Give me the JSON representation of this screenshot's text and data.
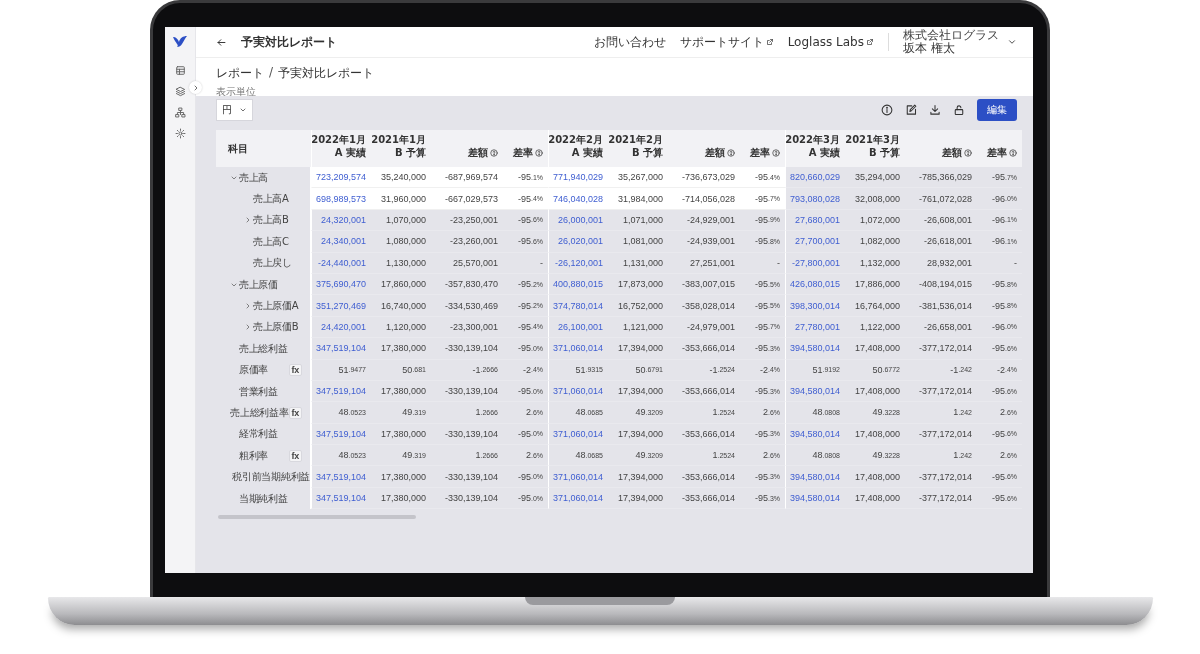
{
  "app": {
    "title": "予実対比レポート"
  },
  "header_links": [
    {
      "label": "お問い合わせ",
      "external": false
    },
    {
      "label": "サポートサイト",
      "external": true
    },
    {
      "label": "Loglass Labs",
      "external": true
    }
  ],
  "user": {
    "company": "株式会社ログラス",
    "name": "坂本 権太"
  },
  "breadcrumb": [
    "レポート",
    "予実対比レポート"
  ],
  "breadcrumb_separator": "/",
  "unit": {
    "label": "表示単位",
    "value": "円"
  },
  "edit_button": "編集",
  "table": {
    "label_header": "科目",
    "months": [
      {
        "current": "2022年1月",
        "actual": "A 実績",
        "prior": "2021年1月",
        "budget": "B 予算",
        "diff": "差額",
        "rate": "差率"
      },
      {
        "current": "2022年2月",
        "actual": "A 実績",
        "prior": "2021年2月",
        "budget": "B 予算",
        "diff": "差額",
        "rate": "差率"
      },
      {
        "current": "2022年3月",
        "actual": "A 実績",
        "prior": "2021年3月",
        "budget": "B 予算",
        "diff": "差額",
        "rate": "差率"
      }
    ],
    "rows": [
      {
        "label": "売上高",
        "kind": "amount",
        "expanded": true,
        "months": [
          {
            "values": [
              "723,209,574",
              "35,240,000",
              "-687,969,574",
              "-95.1%"
            ],
            "highlighted": true
          },
          {
            "values": [
              "771,940,029",
              "35,267,000",
              "-736,673,029",
              "-95.4%"
            ],
            "highlighted": true
          },
          {
            "values": [
              "820,660,029",
              "35,294,000",
              "-785,366,029",
              "-95.7%"
            ],
            "highlighted": false
          }
        ],
        "children": [
          {
            "label": "売上高A",
            "kind": "amount",
            "months": [
              {
                "values": [
                  "698,989,573",
                  "31,960,000",
                  "-667,029,573",
                  "-95.4%"
                ],
                "highlighted": true
              },
              {
                "values": [
                  "746,040,028",
                  "31,984,000",
                  "-714,056,028",
                  "-95.7%"
                ],
                "highlighted": true
              },
              {
                "values": [
                  "793,080,028",
                  "32,008,000",
                  "-761,072,028",
                  "-96.0%"
                ],
                "highlighted": false
              }
            ]
          },
          {
            "label": "売上高B",
            "kind": "amount",
            "expanded": false,
            "months": [
              {
                "values": [
                  "24,320,001",
                  "1,070,000",
                  "-23,250,001",
                  "-95.6%"
                ],
                "highlighted": false
              },
              {
                "values": [
                  "26,000,001",
                  "1,071,000",
                  "-24,929,001",
                  "-95.9%"
                ],
                "highlighted": false
              },
              {
                "values": [
                  "27,680,001",
                  "1,072,000",
                  "-26,608,001",
                  "-96.1%"
                ],
                "highlighted": false
              }
            ]
          },
          {
            "label": "売上高C",
            "kind": "amount",
            "months": [
              {
                "values": [
                  "24,340,001",
                  "1,080,000",
                  "-23,260,001",
                  "-95.6%"
                ],
                "highlighted": false
              },
              {
                "values": [
                  "26,020,001",
                  "1,081,000",
                  "-24,939,001",
                  "-95.8%"
                ],
                "highlighted": false
              },
              {
                "values": [
                  "27,700,001",
                  "1,082,000",
                  "-26,618,001",
                  "-96.1%"
                ],
                "highlighted": false
              }
            ]
          },
          {
            "label": "売上戻し",
            "kind": "amount",
            "months": [
              {
                "values": [
                  "-24,440,001",
                  "1,130,000",
                  "25,570,001",
                  "-"
                ],
                "highlighted": false
              },
              {
                "values": [
                  "-26,120,001",
                  "1,131,000",
                  "27,251,001",
                  "-"
                ],
                "highlighted": false
              },
              {
                "values": [
                  "-27,800,001",
                  "1,132,000",
                  "28,932,001",
                  "-"
                ],
                "highlighted": false
              }
            ]
          }
        ]
      },
      {
        "label": "売上原価",
        "kind": "amount",
        "expanded": true,
        "months": [
          {
            "values": [
              "375,690,470",
              "17,860,000",
              "-357,830,470",
              "-95.2%"
            ],
            "highlighted": false
          },
          {
            "values": [
              "400,880,015",
              "17,873,000",
              "-383,007,015",
              "-95.5%"
            ],
            "highlighted": false
          },
          {
            "values": [
              "426,080,015",
              "17,886,000",
              "-408,194,015",
              "-95.8%"
            ],
            "highlighted": false
          }
        ],
        "children": [
          {
            "label": "売上原価A",
            "kind": "amount",
            "expanded": false,
            "months": [
              {
                "values": [
                  "351,270,469",
                  "16,740,000",
                  "-334,530,469",
                  "-95.2%"
                ],
                "highlighted": false
              },
              {
                "values": [
                  "374,780,014",
                  "16,752,000",
                  "-358,028,014",
                  "-95.5%"
                ],
                "highlighted": false
              },
              {
                "values": [
                  "398,300,014",
                  "16,764,000",
                  "-381,536,014",
                  "-95.8%"
                ],
                "highlighted": false
              }
            ]
          },
          {
            "label": "売上原価B",
            "kind": "amount",
            "expanded": false,
            "months": [
              {
                "values": [
                  "24,420,001",
                  "1,120,000",
                  "-23,300,001",
                  "-95.4%"
                ],
                "highlighted": false
              },
              {
                "values": [
                  "26,100,001",
                  "1,121,000",
                  "-24,979,001",
                  "-95.7%"
                ],
                "highlighted": false
              },
              {
                "values": [
                  "27,780,001",
                  "1,122,000",
                  "-26,658,001",
                  "-96.0%"
                ],
                "highlighted": false
              }
            ]
          }
        ]
      },
      {
        "label": "売上総利益",
        "kind": "amount",
        "months": [
          {
            "values": [
              "347,519,104",
              "17,380,000",
              "-330,139,104",
              "-95.0%"
            ],
            "highlighted": false
          },
          {
            "values": [
              "371,060,014",
              "17,394,000",
              "-353,666,014",
              "-95.3%"
            ],
            "highlighted": false
          },
          {
            "values": [
              "394,580,014",
              "17,408,000",
              "-377,172,014",
              "-95.6%"
            ],
            "highlighted": false
          }
        ]
      },
      {
        "label": "原価率",
        "kind": "ratio",
        "badge": "fx",
        "months": [
          {
            "values": [
              "51.9477",
              "50.681",
              "-1.2666",
              "-2.4%"
            ],
            "highlighted": false
          },
          {
            "values": [
              "51.9315",
              "50.6791",
              "-1.2524",
              "-2.4%"
            ],
            "highlighted": false
          },
          {
            "values": [
              "51.9192",
              "50.6772",
              "-1.242",
              "-2.4%"
            ],
            "highlighted": false
          }
        ]
      },
      {
        "label": "営業利益",
        "kind": "amount",
        "months": [
          {
            "values": [
              "347,519,104",
              "17,380,000",
              "-330,139,104",
              "-95.0%"
            ],
            "highlighted": false
          },
          {
            "values": [
              "371,060,014",
              "17,394,000",
              "-353,666,014",
              "-95.3%"
            ],
            "highlighted": false
          },
          {
            "values": [
              "394,580,014",
              "17,408,000",
              "-377,172,014",
              "-95.6%"
            ],
            "highlighted": false
          }
        ]
      },
      {
        "label": "売上総利益率",
        "kind": "ratio",
        "badge": "fx",
        "months": [
          {
            "values": [
              "48.0523",
              "49.319",
              "1.2666",
              "2.6%"
            ],
            "highlighted": false
          },
          {
            "values": [
              "48.0685",
              "49.3209",
              "1.2524",
              "2.6%"
            ],
            "highlighted": false
          },
          {
            "values": [
              "48.0808",
              "49.3228",
              "1.242",
              "2.6%"
            ],
            "highlighted": false
          }
        ]
      },
      {
        "label": "経常利益",
        "kind": "amount",
        "months": [
          {
            "values": [
              "347,519,104",
              "17,380,000",
              "-330,139,104",
              "-95.0%"
            ],
            "highlighted": false
          },
          {
            "values": [
              "371,060,014",
              "17,394,000",
              "-353,666,014",
              "-95.3%"
            ],
            "highlighted": false
          },
          {
            "values": [
              "394,580,014",
              "17,408,000",
              "-377,172,014",
              "-95.6%"
            ],
            "highlighted": false
          }
        ]
      },
      {
        "label": "粗利率",
        "kind": "ratio",
        "badge": "fx",
        "months": [
          {
            "values": [
              "48.0523",
              "49.319",
              "1.2666",
              "2.6%"
            ],
            "highlighted": false
          },
          {
            "values": [
              "48.0685",
              "49.3209",
              "1.2524",
              "2.6%"
            ],
            "highlighted": false
          },
          {
            "values": [
              "48.0808",
              "49.3228",
              "1.242",
              "2.6%"
            ],
            "highlighted": false
          }
        ]
      },
      {
        "label": "税引前当期純利益",
        "kind": "amount",
        "months": [
          {
            "values": [
              "347,519,104",
              "17,380,000",
              "-330,139,104",
              "-95.0%"
            ],
            "highlighted": false
          },
          {
            "values": [
              "371,060,014",
              "17,394,000",
              "-353,666,014",
              "-95.3%"
            ],
            "highlighted": false
          },
          {
            "values": [
              "394,580,014",
              "17,408,000",
              "-377,172,014",
              "-95.6%"
            ],
            "highlighted": false
          }
        ]
      },
      {
        "label": "当期純利益",
        "kind": "amount",
        "months": [
          {
            "values": [
              "347,519,104",
              "17,380,000",
              "-330,139,104",
              "-95.0%"
            ],
            "highlighted": false
          },
          {
            "values": [
              "371,060,014",
              "17,394,000",
              "-353,666,014",
              "-95.3%"
            ],
            "highlighted": false
          },
          {
            "values": [
              "394,580,014",
              "17,408,000",
              "-377,172,014",
              "-95.6%"
            ],
            "highlighted": false
          }
        ]
      }
    ]
  }
}
